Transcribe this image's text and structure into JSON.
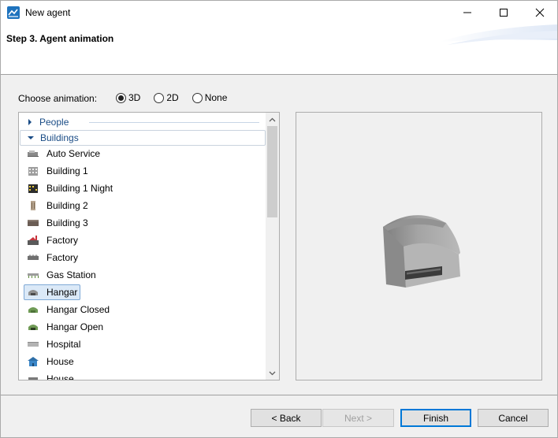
{
  "window": {
    "title": "New agent",
    "minimize_icon": "minimize-icon",
    "maximize_icon": "maximize-icon",
    "close_icon": "close-icon"
  },
  "header": {
    "step_title": "Step 3. Agent animation"
  },
  "animation": {
    "label": "Choose animation:",
    "options": [
      "3D",
      "2D",
      "None"
    ],
    "selected": "3D"
  },
  "tree": {
    "categories": [
      {
        "label": "People",
        "expanded": false
      },
      {
        "label": "Buildings",
        "expanded": true
      }
    ],
    "items": [
      {
        "label": "Auto Service",
        "icon": "auto-service-icon"
      },
      {
        "label": "Building 1",
        "icon": "building-1-icon"
      },
      {
        "label": "Building 1 Night",
        "icon": "building-1-night-icon"
      },
      {
        "label": "Building 2",
        "icon": "building-2-icon"
      },
      {
        "label": "Building 3",
        "icon": "building-3-icon"
      },
      {
        "label": "Factory",
        "icon": "factory-red-icon"
      },
      {
        "label": "Factory",
        "icon": "factory-gray-icon"
      },
      {
        "label": "Gas Station",
        "icon": "gas-station-icon"
      },
      {
        "label": "Hangar",
        "icon": "hangar-icon"
      },
      {
        "label": "Hangar Closed",
        "icon": "hangar-closed-icon"
      },
      {
        "label": "Hangar Open",
        "icon": "hangar-open-icon"
      },
      {
        "label": "Hospital",
        "icon": "hospital-icon"
      },
      {
        "label": "House",
        "icon": "house-icon"
      },
      {
        "label": "House",
        "icon": "house-partial-icon"
      }
    ],
    "selected_item": "Hangar"
  },
  "preview": {
    "model_name": "hangar-3d-model"
  },
  "buttons": {
    "back": "< Back",
    "next": "Next >",
    "finish": "Finish",
    "cancel": "Cancel"
  },
  "colors": {
    "accent": "#0078d7",
    "category_text": "#1a4c86",
    "selection_bg": "#dbe9f7"
  }
}
